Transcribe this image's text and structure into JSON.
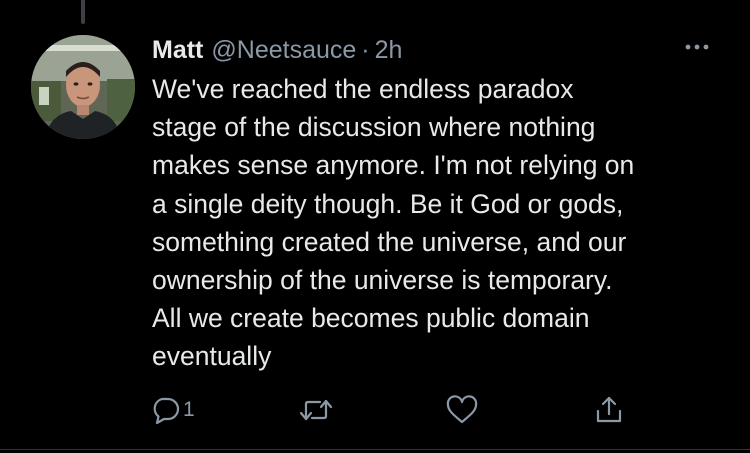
{
  "tweet": {
    "author": {
      "name": "Matt",
      "handle": "@Neetsauce",
      "avatar_icon": "profile-photo-avatar"
    },
    "separator": "·",
    "time": "2h",
    "text": "We've reached the endless paradox\nstage of the discussion where nothing\nmakes sense anymore. I'm not relying on\na single deity though. Be it God or gods,\nsomething created the universe, and our\nownership of the universe is temporary.\nAll we create becomes public domain\neventually",
    "menu_icon": "more-dots-icon",
    "actions": {
      "reply": {
        "icon": "reply-icon",
        "count": "1"
      },
      "retweet": {
        "icon": "retweet-icon"
      },
      "like": {
        "icon": "heart-icon"
      },
      "share": {
        "icon": "share-icon"
      }
    }
  },
  "colors": {
    "background": "#000000",
    "text_primary": "#e7e9ea",
    "text_secondary": "#8b98a5",
    "thread_line": "#3d4146"
  }
}
